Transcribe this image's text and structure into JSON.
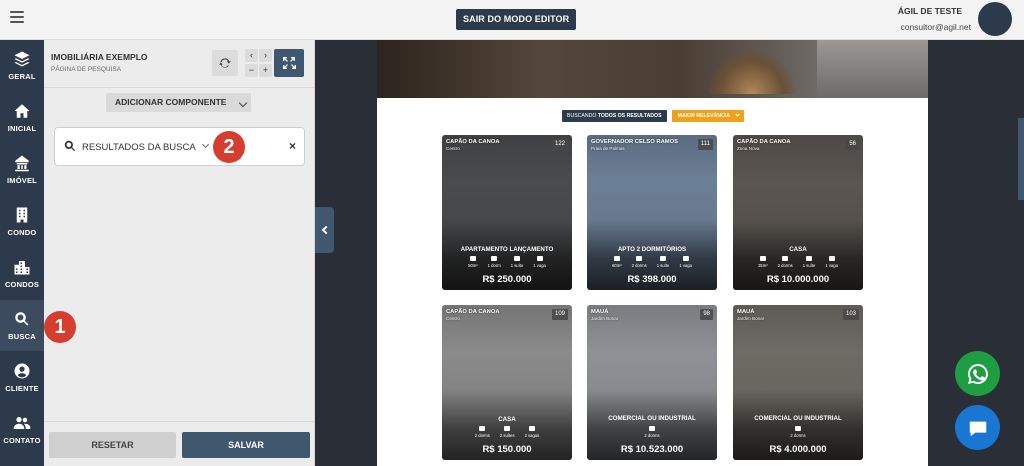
{
  "topbar": {
    "editor_button": "SAIR DO MODO EDITOR",
    "user_name": "ÁGIL DE TESTE",
    "user_email": "consultor@agil.net"
  },
  "nav": {
    "items": [
      {
        "label": "GERAL",
        "icon": "layers-icon"
      },
      {
        "label": "INICIAL",
        "icon": "home-icon"
      },
      {
        "label": "IMÓVEL",
        "icon": "house-icon"
      },
      {
        "label": "CONDO",
        "icon": "building-icon"
      },
      {
        "label": "CONDOS",
        "icon": "city-icon"
      },
      {
        "label": "BUSCA",
        "icon": "search-icon"
      },
      {
        "label": "CLIENTE",
        "icon": "user-icon"
      },
      {
        "label": "CONTATO",
        "icon": "users-icon"
      }
    ],
    "active": "BUSCA"
  },
  "panel": {
    "title": "IMOBILIÁRIA EXEMPLO",
    "subtitle": "PÁGINA DE PESQUISA",
    "add_component": "ADICIONAR COMPONENTE",
    "component_label": "RESULTADOS DA BUSCA",
    "reset": "RESETAR",
    "save": "SALVAR",
    "callout_1": "1",
    "callout_2": "2",
    "zoom_minus": "−",
    "zoom_plus": "+"
  },
  "filters": {
    "prefix": "BUSCANDO",
    "scope": "TODOS OS RESULTADOS",
    "sort": "MAIOR RELEVÂNCIA"
  },
  "properties": [
    {
      "location": "CAPÃO DA CANOA",
      "sublocation": "Centro",
      "id": "122",
      "type": "APARTAMENTO LANÇAMENTO",
      "features": [
        "50m²",
        "1 dorm",
        "1 suíte",
        "1 vaga"
      ],
      "price": "R$ 250.000",
      "bg": "#4a4b4d"
    },
    {
      "location": "GOVERNADOR CELSO RAMOS",
      "sublocation": "Praia de Palmas",
      "id": "111",
      "type": "APTO 2 DORMITÓRIOS",
      "features": [
        "60m²",
        "2 dorms",
        "1 suíte",
        "1 vaga"
      ],
      "price": "R$ 398.000",
      "bg": "#6b7f96"
    },
    {
      "location": "CAPÃO DA CANOA",
      "sublocation": "Zona Nova",
      "id": "56",
      "type": "CASA",
      "features": [
        "35m²",
        "2 dorms",
        "1 suíte",
        "1 vaga"
      ],
      "price": "R$ 10.000.000",
      "bg": "#5a5551"
    },
    {
      "location": "CAPÃO DA CANOA",
      "sublocation": "Centro",
      "id": "109",
      "type": "CASA",
      "features": [
        "2 dorms",
        "2 suítes",
        "2 vagas"
      ],
      "price": "R$ 150.000",
      "bg": "#8a8a8a"
    },
    {
      "location": "MAUÁ",
      "sublocation": "Jardim Bonar",
      "id": "98",
      "type": "COMERCIAL OU INDUSTRIAL",
      "features": [
        "2 dorms"
      ],
      "price": "R$ 10.523.000",
      "bg": "#8e9296"
    },
    {
      "location": "MAUÁ",
      "sublocation": "Jardim Bonar",
      "id": "103",
      "type": "COMERCIAL OU INDUSTRIAL",
      "features": [
        "2 dorms"
      ],
      "price": "R$ 4.000.000",
      "bg": "#6e6a64"
    }
  ],
  "floating": {
    "whatsapp_icon": "whatsapp-icon",
    "chat_icon": "chat-icon",
    "whatsapp_color": "#1f9d43",
    "chat_color": "#1976d2"
  },
  "colors": {
    "nav_bg": "#2d3a4b",
    "accent": "#3f5870",
    "callout": "#d63d2e",
    "sort_badge": "#f0a11c"
  }
}
